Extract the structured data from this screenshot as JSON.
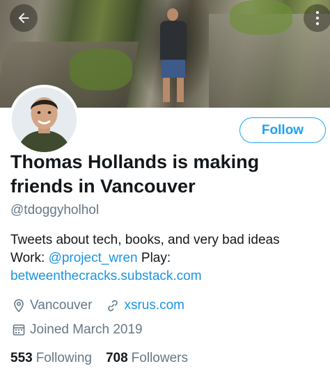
{
  "profile": {
    "display_name": "Thomas Hollands is making friends in Vancouver",
    "handle": "@tdoggyholhol",
    "bio_text": "Tweets about tech, books, and very bad ideas Work: ",
    "bio_mention": "@project_wren",
    "bio_play": " Play: ",
    "bio_link": "betweenthecracks.substack.com",
    "location": "Vancouver",
    "website": "xsrus.com",
    "joined": "Joined March 2019",
    "following_count": "553",
    "following_label": "Following",
    "followers_count": "708",
    "followers_label": "Followers"
  },
  "actions": {
    "follow_label": "Follow"
  },
  "icons": {
    "back": "back-arrow-icon",
    "more": "more-vertical-icon",
    "location": "location-pin-icon",
    "link": "link-icon",
    "calendar": "calendar-icon"
  },
  "colors": {
    "accent": "#1da1f2",
    "link": "#1b95e0",
    "secondary_text": "#657786"
  }
}
